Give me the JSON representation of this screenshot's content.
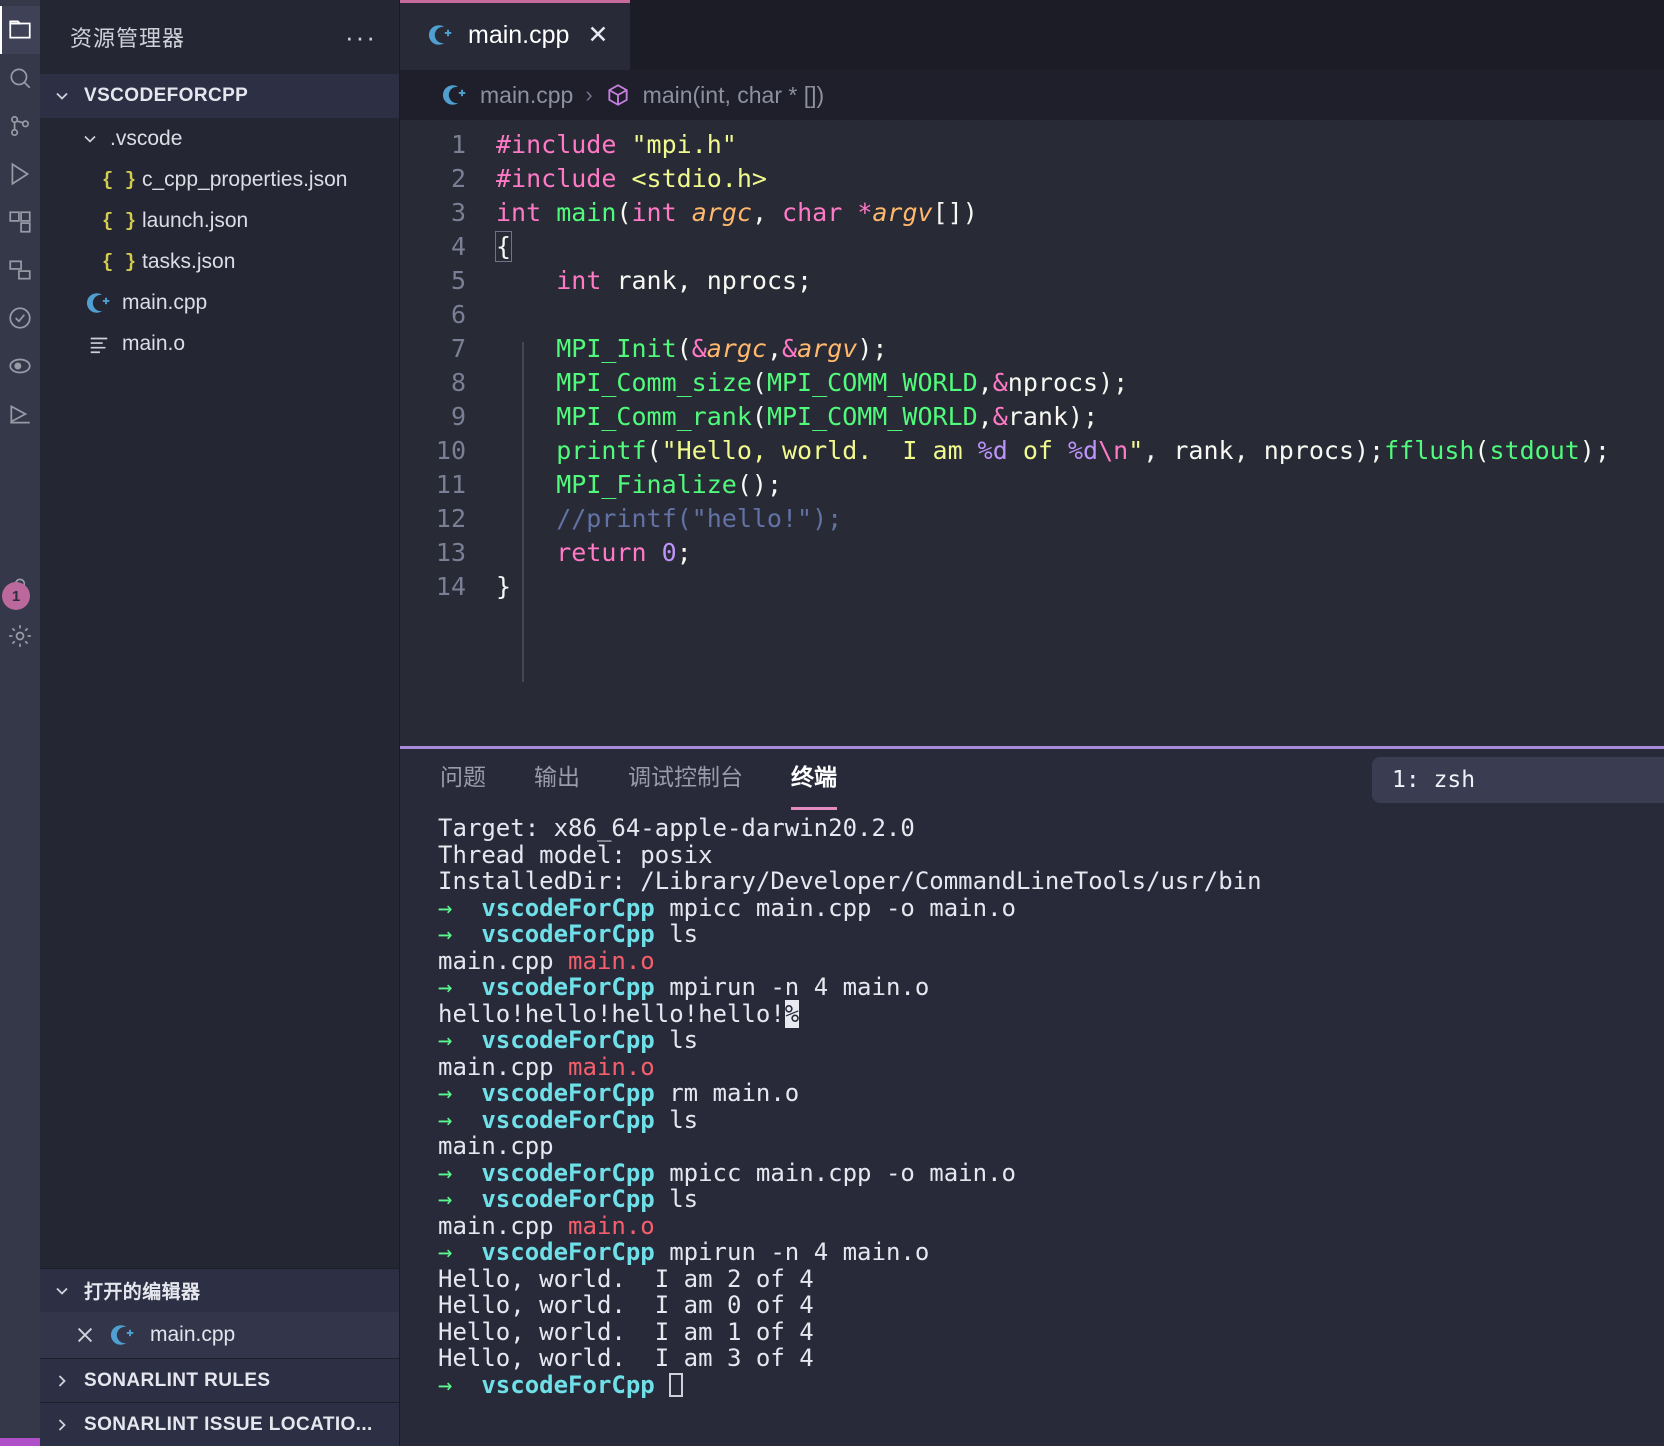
{
  "activity_bar": {
    "items": [
      {
        "name": "explorer-icon",
        "active": true
      },
      {
        "name": "search-icon",
        "active": false
      },
      {
        "name": "source-control-icon",
        "active": false
      },
      {
        "name": "run-debug-icon",
        "active": false
      },
      {
        "name": "extensions-icon",
        "active": false
      },
      {
        "name": "remote-explorer-icon",
        "active": false
      },
      {
        "name": "testing-icon",
        "active": false
      },
      {
        "name": "docker-icon",
        "active": false
      },
      {
        "name": "run-icon",
        "active": false
      },
      {
        "name": "account-icon",
        "active": false
      },
      {
        "name": "settings-gear-icon",
        "active": false
      }
    ],
    "badge_count": "1"
  },
  "sidebar": {
    "title": "资源管理器",
    "more_actions": "···",
    "root_folder": "VSCODEFORCPP",
    "tree": [
      {
        "label": ".vscode",
        "type": "folder",
        "indent": 0,
        "expanded": true
      },
      {
        "label": "c_cpp_properties.json",
        "type": "json",
        "indent": 1
      },
      {
        "label": "launch.json",
        "type": "json",
        "indent": 1
      },
      {
        "label": "tasks.json",
        "type": "json",
        "indent": 1
      },
      {
        "label": "main.cpp",
        "type": "cpp",
        "indent": 0
      },
      {
        "label": "main.o",
        "type": "object",
        "indent": 0
      }
    ],
    "sections": [
      {
        "label": "打开的编辑器",
        "expanded": true
      },
      {
        "label": "SONARLINT RULES",
        "expanded": false
      },
      {
        "label": "SONARLINT ISSUE LOCATIO...",
        "expanded": false
      }
    ],
    "open_editors": [
      {
        "label": "main.cpp",
        "type": "cpp",
        "active": true
      }
    ]
  },
  "editor": {
    "tab": {
      "label": "main.cpp",
      "close": "✕"
    },
    "breadcrumb": {
      "file": "main.cpp",
      "separator": "›",
      "symbol": "main(int, char * [])"
    },
    "lines": [
      {
        "n": "1",
        "tokens": [
          {
            "t": "#include ",
            "c": "t-pre"
          },
          {
            "t": "\"mpi.h\"",
            "c": "t-str"
          }
        ]
      },
      {
        "n": "2",
        "tokens": [
          {
            "t": "#include ",
            "c": "t-pre"
          },
          {
            "t": "<stdio.h>",
            "c": "t-str"
          }
        ]
      },
      {
        "n": "3",
        "tokens": [
          {
            "t": "int ",
            "c": "t-kw"
          },
          {
            "t": "main",
            "c": "t-fn"
          },
          {
            "t": "(",
            "c": "t-plain"
          },
          {
            "t": "int ",
            "c": "t-kw"
          },
          {
            "t": "argc",
            "c": "t-param"
          },
          {
            "t": ", ",
            "c": "t-plain"
          },
          {
            "t": "char ",
            "c": "t-kw"
          },
          {
            "t": "*",
            "c": "t-op"
          },
          {
            "t": "argv",
            "c": "t-param"
          },
          {
            "t": "[])",
            "c": "t-plain"
          }
        ]
      },
      {
        "n": "4",
        "tokens": [
          {
            "t": "{",
            "c": "t-plain cursor-box"
          }
        ]
      },
      {
        "n": "5",
        "tokens": [
          {
            "t": "    ",
            "c": "t-plain"
          },
          {
            "t": "int ",
            "c": "t-kw"
          },
          {
            "t": "rank, nprocs;",
            "c": "t-plain"
          }
        ]
      },
      {
        "n": "6",
        "tokens": [
          {
            "t": "",
            "c": "t-plain"
          }
        ]
      },
      {
        "n": "7",
        "tokens": [
          {
            "t": "    ",
            "c": "t-plain"
          },
          {
            "t": "MPI_Init",
            "c": "t-fn"
          },
          {
            "t": "(",
            "c": "t-plain"
          },
          {
            "t": "&",
            "c": "t-op"
          },
          {
            "t": "argc",
            "c": "t-param"
          },
          {
            "t": ",",
            "c": "t-plain"
          },
          {
            "t": "&",
            "c": "t-op"
          },
          {
            "t": "argv",
            "c": "t-param"
          },
          {
            "t": ");",
            "c": "t-plain"
          }
        ]
      },
      {
        "n": "8",
        "tokens": [
          {
            "t": "    ",
            "c": "t-plain"
          },
          {
            "t": "MPI_Comm_size",
            "c": "t-fn"
          },
          {
            "t": "(",
            "c": "t-plain"
          },
          {
            "t": "MPI_COMM_WORLD",
            "c": "t-fn"
          },
          {
            "t": ",",
            "c": "t-plain"
          },
          {
            "t": "&",
            "c": "t-op"
          },
          {
            "t": "nprocs",
            "c": "t-plain"
          },
          {
            "t": ");",
            "c": "t-plain"
          }
        ]
      },
      {
        "n": "9",
        "tokens": [
          {
            "t": "    ",
            "c": "t-plain"
          },
          {
            "t": "MPI_Comm_rank",
            "c": "t-fn"
          },
          {
            "t": "(",
            "c": "t-plain"
          },
          {
            "t": "MPI_COMM_WORLD",
            "c": "t-fn"
          },
          {
            "t": ",",
            "c": "t-plain"
          },
          {
            "t": "&",
            "c": "t-op"
          },
          {
            "t": "rank",
            "c": "t-plain"
          },
          {
            "t": ");",
            "c": "t-plain"
          }
        ]
      },
      {
        "n": "10",
        "tokens": [
          {
            "t": "    ",
            "c": "t-plain"
          },
          {
            "t": "printf",
            "c": "t-fn"
          },
          {
            "t": "(",
            "c": "t-plain"
          },
          {
            "t": "\"Hello, world.  I am ",
            "c": "t-str"
          },
          {
            "t": "%d",
            "c": "t-spec"
          },
          {
            "t": " of ",
            "c": "t-str"
          },
          {
            "t": "%d",
            "c": "t-spec"
          },
          {
            "t": "\\n",
            "c": "t-esc"
          },
          {
            "t": "\"",
            "c": "t-str"
          },
          {
            "t": ", rank, nprocs);",
            "c": "t-plain"
          },
          {
            "t": "fflush",
            "c": "t-fn"
          },
          {
            "t": "(",
            "c": "t-plain"
          },
          {
            "t": "stdout",
            "c": "t-fn"
          },
          {
            "t": ");",
            "c": "t-plain"
          }
        ]
      },
      {
        "n": "11",
        "tokens": [
          {
            "t": "    ",
            "c": "t-plain"
          },
          {
            "t": "MPI_Finalize",
            "c": "t-fn"
          },
          {
            "t": "();",
            "c": "t-plain"
          }
        ]
      },
      {
        "n": "12",
        "tokens": [
          {
            "t": "    //printf(\"hello!\");",
            "c": "t-com"
          }
        ]
      },
      {
        "n": "13",
        "tokens": [
          {
            "t": "    ",
            "c": "t-plain"
          },
          {
            "t": "return ",
            "c": "t-kw"
          },
          {
            "t": "0",
            "c": "t-num"
          },
          {
            "t": ";",
            "c": "t-plain"
          }
        ]
      },
      {
        "n": "14",
        "tokens": [
          {
            "t": "}",
            "c": "t-plain"
          }
        ]
      }
    ]
  },
  "panel": {
    "tabs": [
      {
        "label": "问题",
        "active": false
      },
      {
        "label": "输出",
        "active": false
      },
      {
        "label": "调试控制台",
        "active": false
      },
      {
        "label": "终端",
        "active": true
      }
    ],
    "terminal_selector": "1: zsh",
    "terminal_lines": [
      [
        {
          "t": "Target: x86_64-apple-darwin20.2.0",
          "c": "plain"
        }
      ],
      [
        {
          "t": "Thread model: posix",
          "c": "plain"
        }
      ],
      [
        {
          "t": "InstalledDir: /Library/Developer/CommandLineTools/usr/bin",
          "c": "plain"
        }
      ],
      [
        {
          "t": "→  ",
          "c": "arrow"
        },
        {
          "t": "vscodeForCpp",
          "c": "dirname"
        },
        {
          "t": " mpicc main.cpp -o main.o",
          "c": "plain"
        }
      ],
      [
        {
          "t": "→  ",
          "c": "arrow"
        },
        {
          "t": "vscodeForCpp",
          "c": "dirname"
        },
        {
          "t": " ls",
          "c": "plain"
        }
      ],
      [
        {
          "t": "main.cpp ",
          "c": "plain"
        },
        {
          "t": "main.o",
          "c": "redfile"
        }
      ],
      [
        {
          "t": "→  ",
          "c": "arrow"
        },
        {
          "t": "vscodeForCpp",
          "c": "dirname"
        },
        {
          "t": " mpirun -n 4 main.o",
          "c": "plain"
        }
      ],
      [
        {
          "t": "hello!hello!hello!hello!",
          "c": "plain"
        },
        {
          "t": "%",
          "c": "pctmark"
        }
      ],
      [
        {
          "t": "→  ",
          "c": "arrow"
        },
        {
          "t": "vscodeForCpp",
          "c": "dirname"
        },
        {
          "t": " ls",
          "c": "plain"
        }
      ],
      [
        {
          "t": "main.cpp ",
          "c": "plain"
        },
        {
          "t": "main.o",
          "c": "redfile"
        }
      ],
      [
        {
          "t": "→  ",
          "c": "arrow"
        },
        {
          "t": "vscodeForCpp",
          "c": "dirname"
        },
        {
          "t": " rm main.o",
          "c": "plain"
        }
      ],
      [
        {
          "t": "→  ",
          "c": "arrow"
        },
        {
          "t": "vscodeForCpp",
          "c": "dirname"
        },
        {
          "t": " ls",
          "c": "plain"
        }
      ],
      [
        {
          "t": "main.cpp",
          "c": "plain"
        }
      ],
      [
        {
          "t": "→  ",
          "c": "arrow"
        },
        {
          "t": "vscodeForCpp",
          "c": "dirname"
        },
        {
          "t": " mpicc main.cpp -o main.o",
          "c": "plain"
        }
      ],
      [
        {
          "t": "→  ",
          "c": "arrow"
        },
        {
          "t": "vscodeForCpp",
          "c": "dirname"
        },
        {
          "t": " ls",
          "c": "plain"
        }
      ],
      [
        {
          "t": "main.cpp ",
          "c": "plain"
        },
        {
          "t": "main.o",
          "c": "redfile"
        }
      ],
      [
        {
          "t": "→  ",
          "c": "arrow"
        },
        {
          "t": "vscodeForCpp",
          "c": "dirname"
        },
        {
          "t": " mpirun -n 4 main.o",
          "c": "plain"
        }
      ],
      [
        {
          "t": "Hello, world.  I am 2 of 4",
          "c": "plain"
        }
      ],
      [
        {
          "t": "Hello, world.  I am 0 of 4",
          "c": "plain"
        }
      ],
      [
        {
          "t": "Hello, world.  I am 1 of 4",
          "c": "plain"
        }
      ],
      [
        {
          "t": "Hello, world.  I am 3 of 4",
          "c": "plain"
        }
      ],
      [
        {
          "t": "→  ",
          "c": "arrow"
        },
        {
          "t": "vscodeForCpp",
          "c": "dirname"
        },
        {
          "t": " ",
          "c": "plain"
        },
        {
          "t": "",
          "c": "caret"
        }
      ]
    ]
  },
  "colors": {
    "accent_tab": "#c76b9e",
    "panel_divider": "#a78bda",
    "badge": "#e879b8",
    "terminal_dir": "#6fe0e8",
    "terminal_arrow": "#5af78e"
  }
}
